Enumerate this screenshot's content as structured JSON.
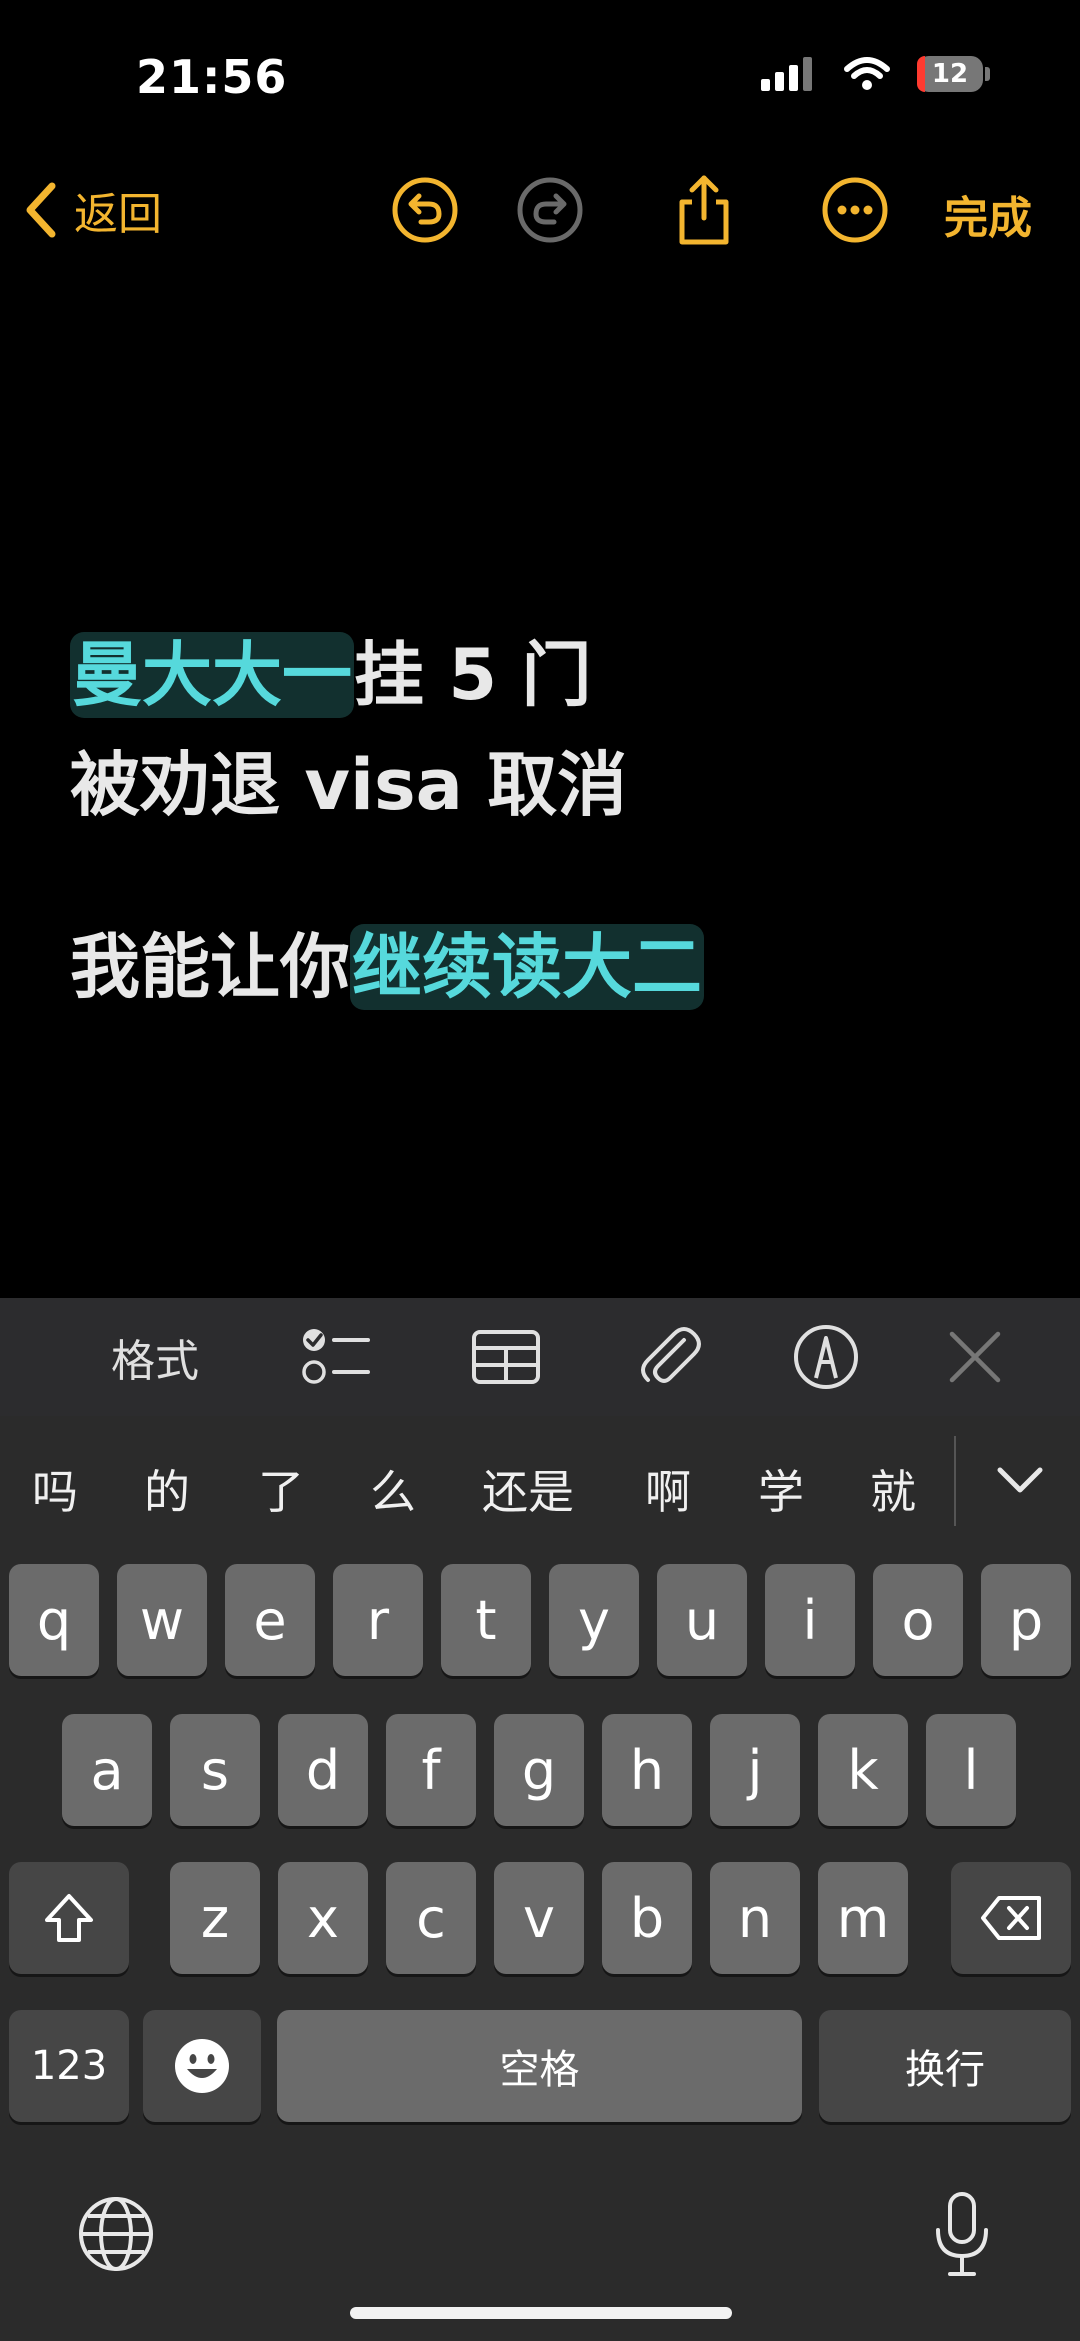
{
  "status_bar": {
    "time": "21:56",
    "battery_level": "12"
  },
  "toolbar": {
    "back_label": "返回",
    "done_label": "完成"
  },
  "note": {
    "line1_highlight": "曼大大一",
    "line1_rest": "挂 5 门",
    "line2": "被劝退 visa 取消",
    "line3_plain": "我能让你",
    "line3_highlight": "继续读大二"
  },
  "format_bar": {
    "format_label": "格式"
  },
  "keyboard": {
    "candidates": [
      "吗",
      "的",
      "了",
      "么",
      "还是",
      "啊",
      "学",
      "就"
    ],
    "row1": [
      "q",
      "w",
      "e",
      "r",
      "t",
      "y",
      "u",
      "i",
      "o",
      "p"
    ],
    "row2": [
      "a",
      "s",
      "d",
      "f",
      "g",
      "h",
      "j",
      "k",
      "l"
    ],
    "row3": [
      "z",
      "x",
      "c",
      "v",
      "b",
      "n",
      "m"
    ],
    "numbers_label": "123",
    "space_label": "空格",
    "return_label": "换行"
  },
  "colors": {
    "accent": "#F3B52F",
    "highlight_text": "#56D9DC",
    "highlight_bg": "#12302F"
  }
}
